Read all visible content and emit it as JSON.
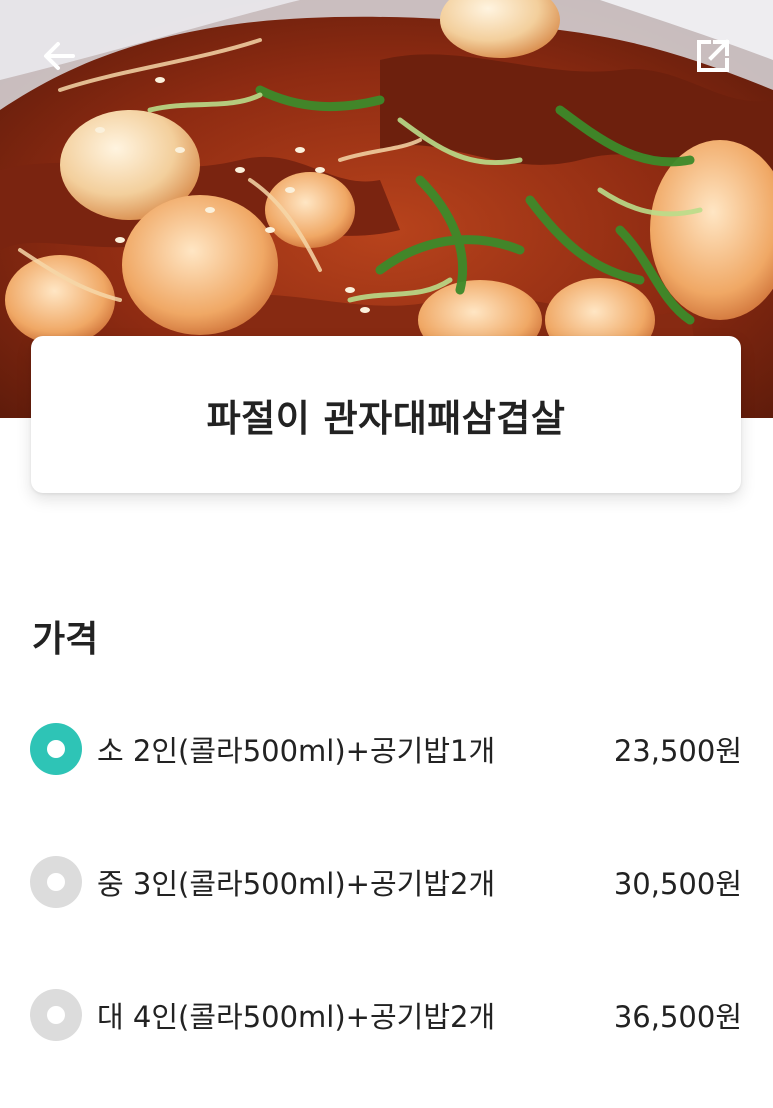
{
  "header": {
    "back_icon": "arrow-left-icon",
    "share_icon": "external-link-icon"
  },
  "menu": {
    "title": "파절이 관자대패삼겹살",
    "image": "food-photo"
  },
  "price_section": {
    "title": "가격",
    "options": [
      {
        "label": "소 2인(콜라500ml)+공기밥1개",
        "price": "23,500원",
        "selected": true
      },
      {
        "label": "중 3인(콜라500ml)+공기밥2개",
        "price": "30,500원",
        "selected": false
      },
      {
        "label": "대 4인(콜라500ml)+공기밥2개",
        "price": "36,500원",
        "selected": false
      }
    ]
  },
  "colors": {
    "accent": "#2ec4b6",
    "radio_unselected": "#dcdcdc",
    "text": "#222222"
  }
}
